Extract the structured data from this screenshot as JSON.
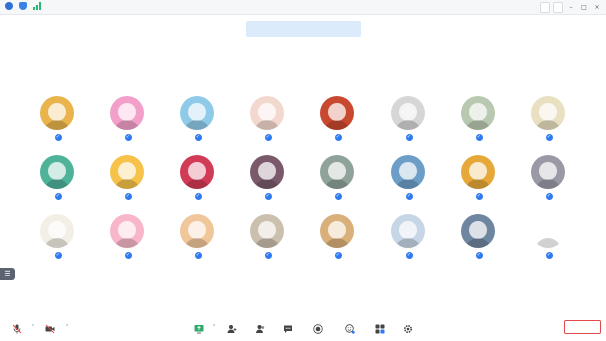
{
  "window": {
    "title": "",
    "right_buttons": [
      "",
      ""
    ],
    "accent": "#2f7af0"
  },
  "toast": {
    "text": ""
  },
  "participants": [
    {
      "name": "",
      "color": "#e9b44c",
      "icon": "avatar-girl-cartoon"
    },
    {
      "name": "",
      "color": "#f2a0c9",
      "icon": "avatar-pink-cartoon"
    },
    {
      "name": "",
      "color": "#8fcbe8",
      "icon": "avatar-doraemon"
    },
    {
      "name": "",
      "color": "#f3d8cf",
      "icon": "avatar-pig-cartoon"
    },
    {
      "name": "",
      "color": "#c8492f",
      "icon": "avatar-photo-man"
    },
    {
      "name": "",
      "color": "#d6d6d6",
      "icon": "avatar-cat"
    },
    {
      "name": "",
      "color": "#b9c8b0",
      "icon": "avatar-sheep"
    },
    {
      "name": "",
      "color": "#e8e0c0",
      "icon": "avatar-girl-cartoon"
    },
    {
      "name": "",
      "color": "#4fb39a",
      "icon": "avatar-girl-cartoon"
    },
    {
      "name": "",
      "color": "#f6c24a",
      "icon": "avatar-tiger-cartoon"
    },
    {
      "name": "",
      "color": "#d13b56",
      "icon": "avatar-cartoon-red"
    },
    {
      "name": "",
      "color": "#7a5a6a",
      "icon": "avatar-flowers"
    },
    {
      "name": "",
      "color": "#8fa39a",
      "icon": "avatar-photo-street"
    },
    {
      "name": "",
      "color": "#6d9ec7",
      "icon": "avatar-seascape"
    },
    {
      "name": "",
      "color": "#e7a83a",
      "icon": "avatar-girl-cartoon"
    },
    {
      "name": "",
      "color": "#9a9aa6",
      "icon": "avatar-photo-person"
    },
    {
      "name": "",
      "color": "#f3efe6",
      "icon": "avatar-girl-sketch"
    },
    {
      "name": "",
      "color": "#f7b7c8",
      "icon": "avatar-pink-girl"
    },
    {
      "name": "",
      "color": "#f0c79a",
      "icon": "avatar-tiger-cartoon"
    },
    {
      "name": "",
      "color": "#cbbfae",
      "icon": "avatar-dog"
    },
    {
      "name": "",
      "color": "#d9b07a",
      "icon": "avatar-girl-cartoon"
    },
    {
      "name": "",
      "color": "#c7d6e6",
      "icon": "avatar-photo-couple"
    },
    {
      "name": "",
      "color": "#6f86a0",
      "icon": "avatar-photo-person"
    },
    {
      "name": "",
      "color": "#ffffff",
      "icon": "avatar-girl-sketch"
    }
  ],
  "toolbar": {
    "mic": {
      "label": "",
      "icon": "mic-off-icon"
    },
    "video": {
      "label": "",
      "icon": "video-off-icon"
    },
    "share": {
      "label": "",
      "icon": "screen-share-icon"
    },
    "invite": {
      "label": "",
      "icon": "add-user-icon"
    },
    "members": {
      "label": "",
      "icon": "members-icon"
    },
    "chat": {
      "label": "",
      "icon": "chat-icon"
    },
    "record": {
      "label": "",
      "icon": "record-icon"
    },
    "react": {
      "label": "",
      "icon": "reaction-icon"
    },
    "apps": {
      "label": "",
      "icon": "apps-icon"
    },
    "settings": {
      "label": "",
      "icon": "gear-icon"
    },
    "end": {
      "label": "",
      "color": "#e04a4a"
    }
  }
}
